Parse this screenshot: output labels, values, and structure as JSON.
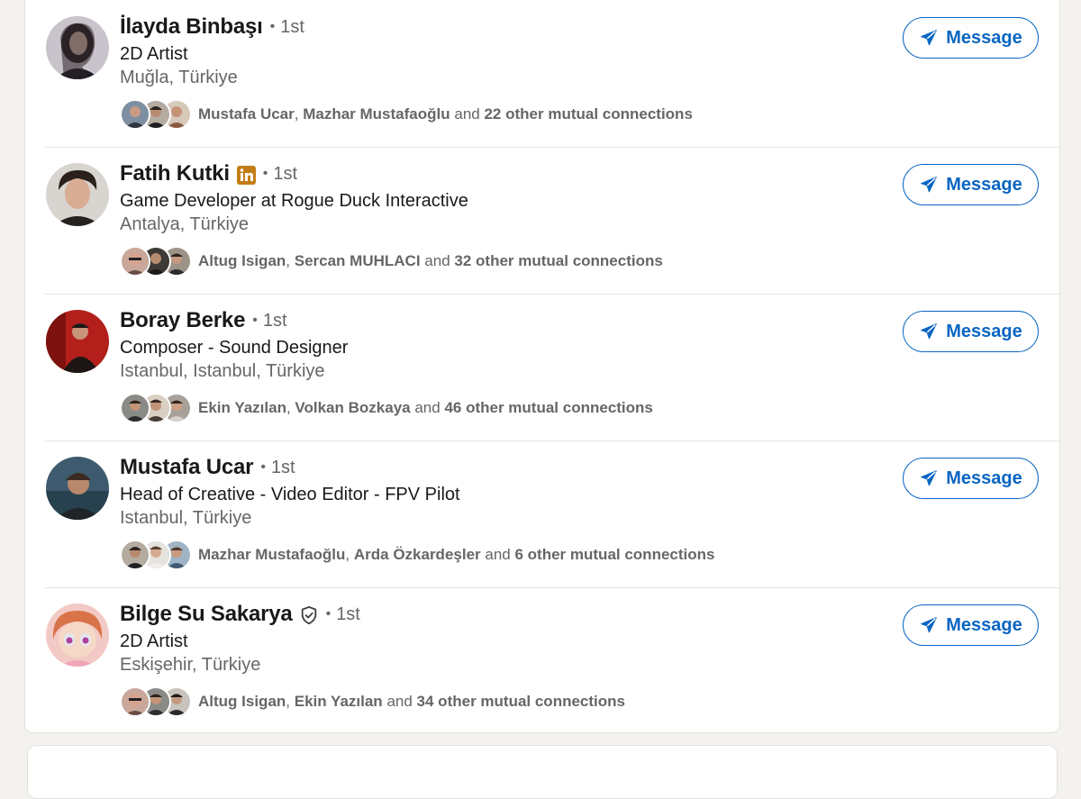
{
  "colors": {
    "accent": "#0a66c2",
    "page_background": "#f4f2ee",
    "muted_text": "#666666",
    "premium_gold": "#c37d16"
  },
  "message_label": "Message",
  "connections": [
    {
      "name": "İlayda Binbaşı",
      "degree": "1st",
      "headline": "2D Artist",
      "location": "Muğla, Türkiye",
      "badge": null,
      "mutual": {
        "first": "Mustafa Ucar",
        "second": "Mazhar Mustafaoğlu",
        "and_word": "and",
        "others": "22 other mutual connections"
      }
    },
    {
      "name": "Fatih Kutki",
      "degree": "1st",
      "headline": "Game Developer at Rogue Duck Interactive",
      "location": "Antalya, Türkiye",
      "badge": "linkedin-premium-icon",
      "mutual": {
        "first": "Altug Isigan",
        "second": "Sercan MUHLACI",
        "and_word": "and",
        "others": "32 other mutual connections"
      }
    },
    {
      "name": "Boray Berke",
      "degree": "1st",
      "headline": "Composer - Sound Designer",
      "location": "Istanbul, Istanbul, Türkiye",
      "badge": null,
      "mutual": {
        "first": "Ekin Yazılan",
        "second": "Volkan Bozkaya",
        "and_word": "and",
        "others": "46 other mutual connections"
      }
    },
    {
      "name": "Mustafa Ucar",
      "degree": "1st",
      "headline": "Head of Creative - Video Editor - FPV Pilot",
      "location": "Istanbul, Türkiye",
      "badge": null,
      "mutual": {
        "first": "Mazhar Mustafaoğlu",
        "second": "Arda Özkardeşler",
        "and_word": "and",
        "others": "6 other mutual connections"
      }
    },
    {
      "name": "Bilge Su Sakarya",
      "degree": "1st",
      "headline": "2D Artist",
      "location": "Eskişehir, Türkiye",
      "badge": "verified-shield-icon",
      "mutual": {
        "first": "Altug Isigan",
        "second": "Ekin Yazılan",
        "and_word": "and",
        "others": "34 other mutual connections"
      }
    }
  ]
}
